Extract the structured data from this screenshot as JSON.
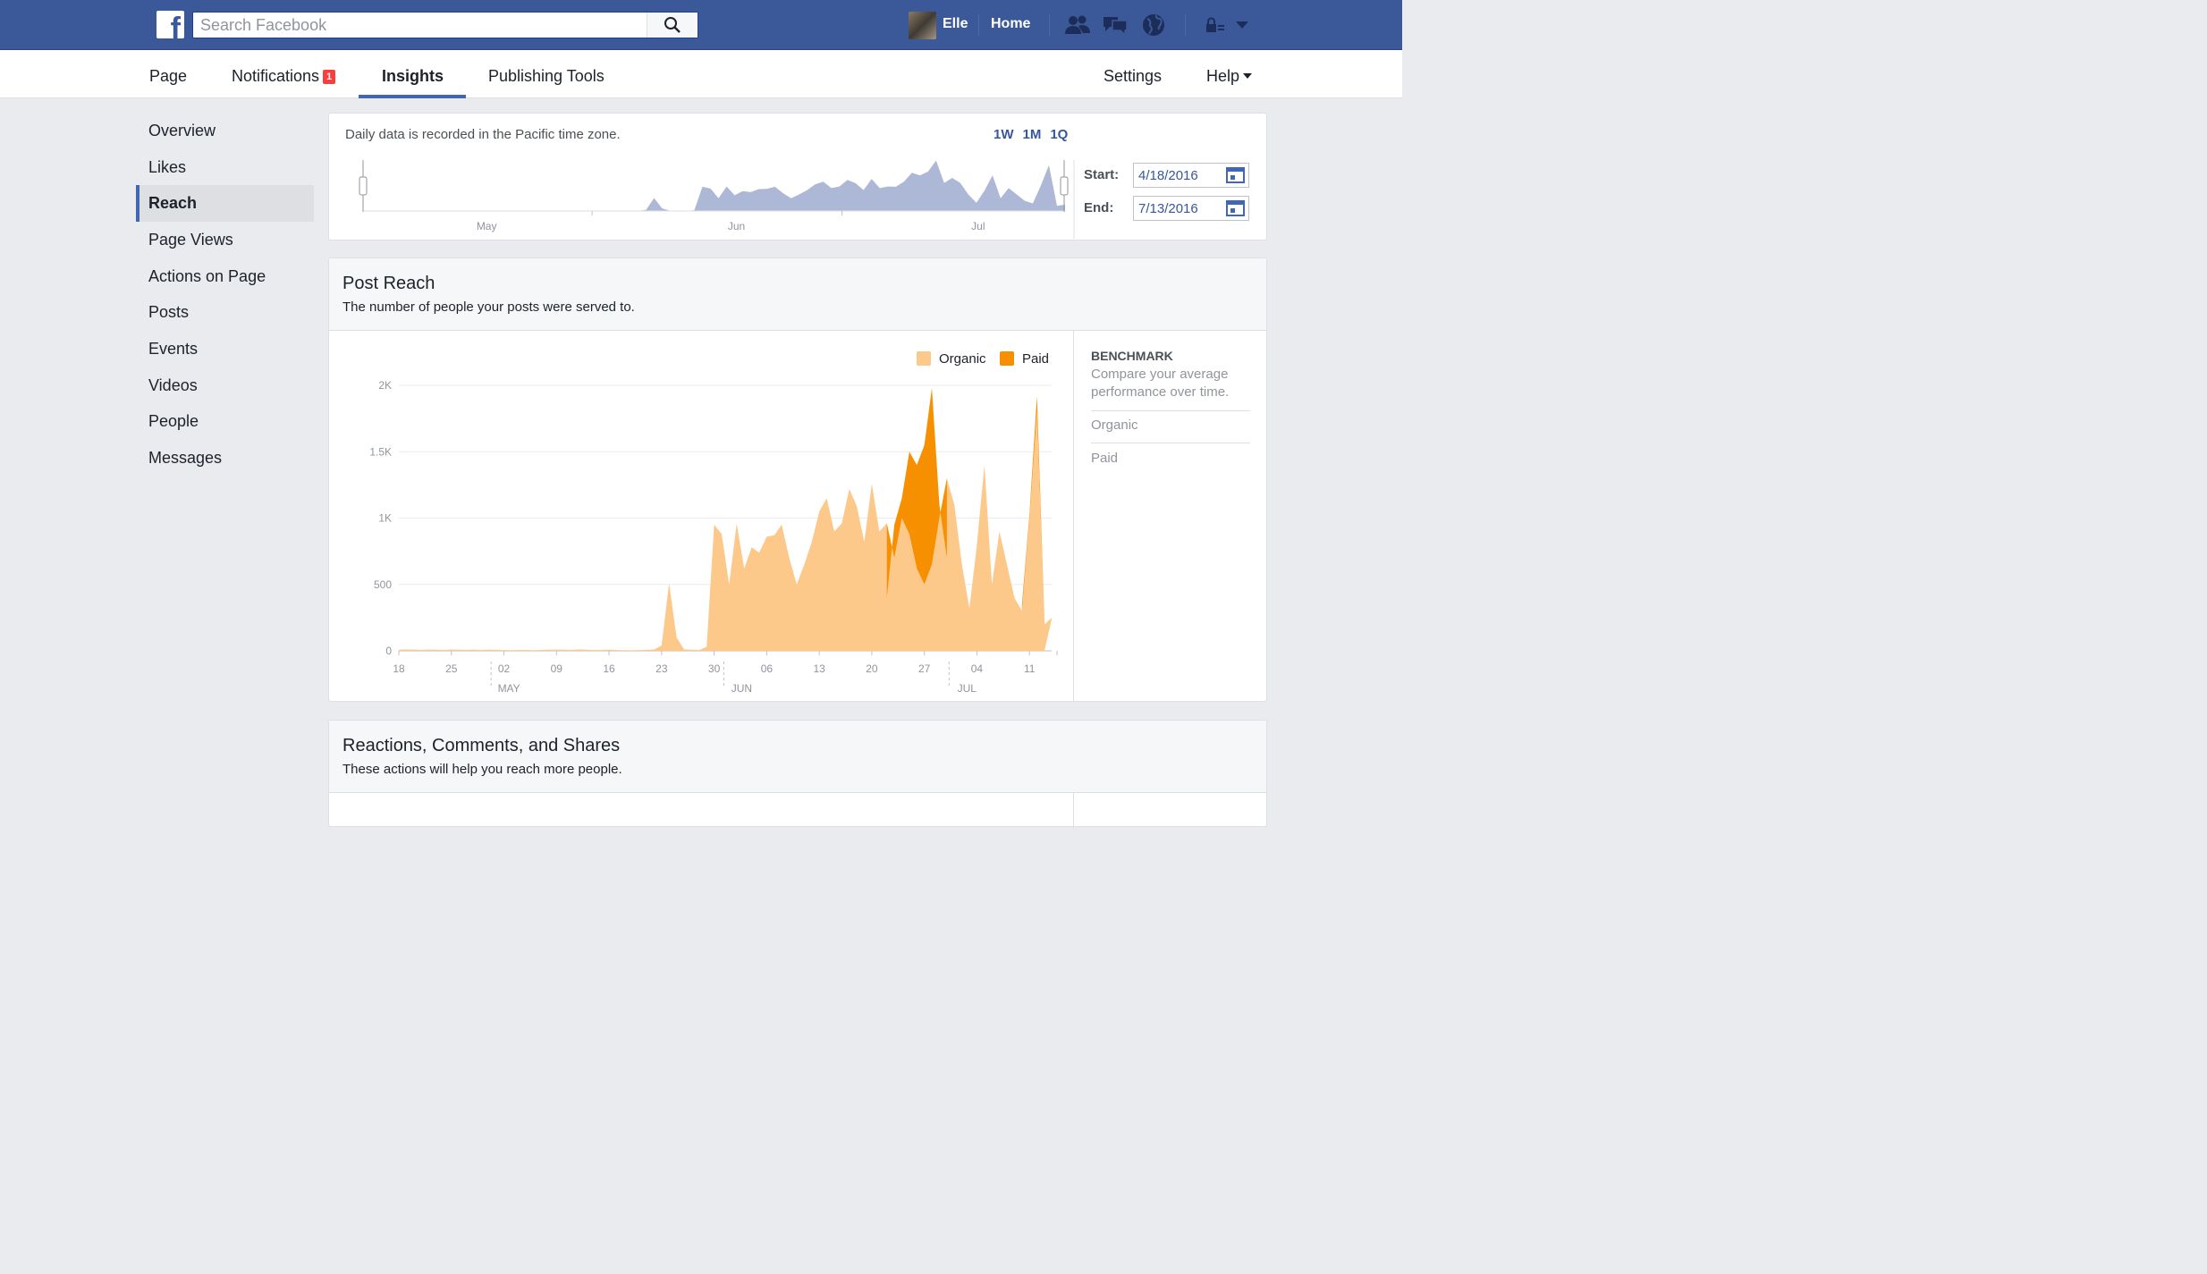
{
  "topbar": {
    "search_placeholder": "Search Facebook",
    "user_name": "Elle",
    "home_label": "Home"
  },
  "tabs": {
    "page": "Page",
    "notifications": "Notifications",
    "notifications_badge": "1",
    "insights": "Insights",
    "publishing_tools": "Publishing Tools",
    "settings": "Settings",
    "help": "Help"
  },
  "sidebar": {
    "items": [
      {
        "label": "Overview"
      },
      {
        "label": "Likes"
      },
      {
        "label": "Reach"
      },
      {
        "label": "Page Views"
      },
      {
        "label": "Actions on Page"
      },
      {
        "label": "Posts"
      },
      {
        "label": "Events"
      },
      {
        "label": "Videos"
      },
      {
        "label": "People"
      },
      {
        "label": "Messages"
      }
    ],
    "active": "Reach"
  },
  "range": {
    "note": "Daily data is recorded in the Pacific time zone.",
    "presets": [
      "1W",
      "1M",
      "1Q"
    ],
    "start_label": "Start:",
    "start_value": "4/18/2016",
    "end_label": "End:",
    "end_value": "7/13/2016",
    "months": [
      "May",
      "Jun",
      "Jul"
    ]
  },
  "post_reach": {
    "title": "Post Reach",
    "subtitle": "The number of people your posts were served to.",
    "benchmark_title": "BENCHMARK",
    "benchmark_desc": "Compare your average performance over time.",
    "benchmark_options": [
      "Organic",
      "Paid"
    ]
  },
  "reactions": {
    "title": "Reactions, Comments, and Shares",
    "subtitle": "These actions will help you reach more people."
  },
  "colors": {
    "organic": "#fdc98a",
    "paid": "#f69000",
    "brand": "#3b5998",
    "mini_fill": "#adb8d6"
  },
  "chart_data": {
    "type": "area",
    "x_unit": "date",
    "x": [
      "4/18",
      "4/19",
      "4/20",
      "4/21",
      "4/22",
      "4/23",
      "4/24",
      "4/25",
      "4/26",
      "4/27",
      "4/28",
      "4/29",
      "4/30",
      "5/1",
      "5/2",
      "5/3",
      "5/4",
      "5/5",
      "5/6",
      "5/7",
      "5/8",
      "5/9",
      "5/10",
      "5/11",
      "5/12",
      "5/13",
      "5/14",
      "5/15",
      "5/16",
      "5/17",
      "5/18",
      "5/19",
      "5/20",
      "5/21",
      "5/22",
      "5/23",
      "5/24",
      "5/25",
      "5/26",
      "5/27",
      "5/28",
      "5/29",
      "5/30",
      "5/31",
      "6/1",
      "6/2",
      "6/3",
      "6/4",
      "6/5",
      "6/6",
      "6/7",
      "6/8",
      "6/9",
      "6/10",
      "6/11",
      "6/12",
      "6/13",
      "6/14",
      "6/15",
      "6/16",
      "6/17",
      "6/18",
      "6/19",
      "6/20",
      "6/21",
      "6/22",
      "6/23",
      "6/24",
      "6/25",
      "6/26",
      "6/27",
      "6/28",
      "6/29",
      "6/30",
      "7/1",
      "7/2",
      "7/3",
      "7/4",
      "7/5",
      "7/6",
      "7/7",
      "7/8",
      "7/9",
      "7/10",
      "7/11",
      "7/12",
      "7/13"
    ],
    "series": [
      {
        "name": "Organic",
        "values": [
          8,
          10,
          9,
          7,
          9,
          8,
          6,
          10,
          8,
          7,
          9,
          6,
          8,
          7,
          6,
          5,
          6,
          7,
          5,
          7,
          8,
          9,
          8,
          7,
          10,
          8,
          6,
          7,
          8,
          6,
          5,
          4,
          6,
          7,
          10,
          40,
          510,
          100,
          10,
          8,
          6,
          30,
          950,
          880,
          500,
          960,
          620,
          780,
          740,
          860,
          870,
          950,
          700,
          500,
          650,
          820,
          1050,
          1150,
          900,
          960,
          1220,
          1090,
          820,
          1260,
          900,
          960,
          700,
          1000,
          880,
          620,
          500,
          650,
          1000,
          1300,
          1100,
          650,
          320,
          800,
          1400,
          500,
          900,
          650,
          400,
          300,
          1000,
          1800,
          200,
          250
        ]
      },
      {
        "name": "Paid",
        "values": [
          0,
          0,
          0,
          0,
          0,
          0,
          0,
          0,
          0,
          0,
          0,
          0,
          0,
          0,
          0,
          0,
          0,
          0,
          0,
          0,
          0,
          0,
          0,
          0,
          0,
          0,
          0,
          0,
          0,
          0,
          0,
          0,
          0,
          0,
          0,
          0,
          0,
          0,
          0,
          0,
          0,
          0,
          0,
          0,
          0,
          0,
          0,
          0,
          0,
          0,
          0,
          0,
          0,
          0,
          0,
          0,
          0,
          0,
          0,
          0,
          0,
          0,
          0,
          0,
          0,
          0,
          0,
          0,
          0,
          0,
          0,
          0,
          0,
          0,
          0,
          0,
          0,
          0,
          0,
          0,
          0,
          0,
          0,
          0,
          0,
          0,
          0,
          0
        ]
      }
    ],
    "paid_overlay": {
      "x": [
        "6/22",
        "6/23",
        "6/24",
        "6/25",
        "6/26",
        "6/27",
        "6/28",
        "6/29",
        "6/30",
        "7/10",
        "7/11",
        "7/12",
        "7/13"
      ],
      "values": [
        400,
        950,
        1150,
        1500,
        1400,
        1550,
        1980,
        1100,
        700,
        50,
        30,
        120,
        20
      ]
    },
    "x_ticks": [
      "18",
      "25",
      "02",
      "09",
      "16",
      "23",
      "30",
      "06",
      "13",
      "20",
      "27",
      "04",
      "11"
    ],
    "x_month_labels": [
      "MAY",
      "JUN",
      "JUL"
    ],
    "y_ticks": [
      "0",
      "500",
      "1K",
      "1.5K",
      "2K"
    ],
    "ylim": [
      0,
      2000
    ],
    "legend": [
      "Organic",
      "Paid"
    ],
    "legend_position": "top-right",
    "grid": true
  }
}
